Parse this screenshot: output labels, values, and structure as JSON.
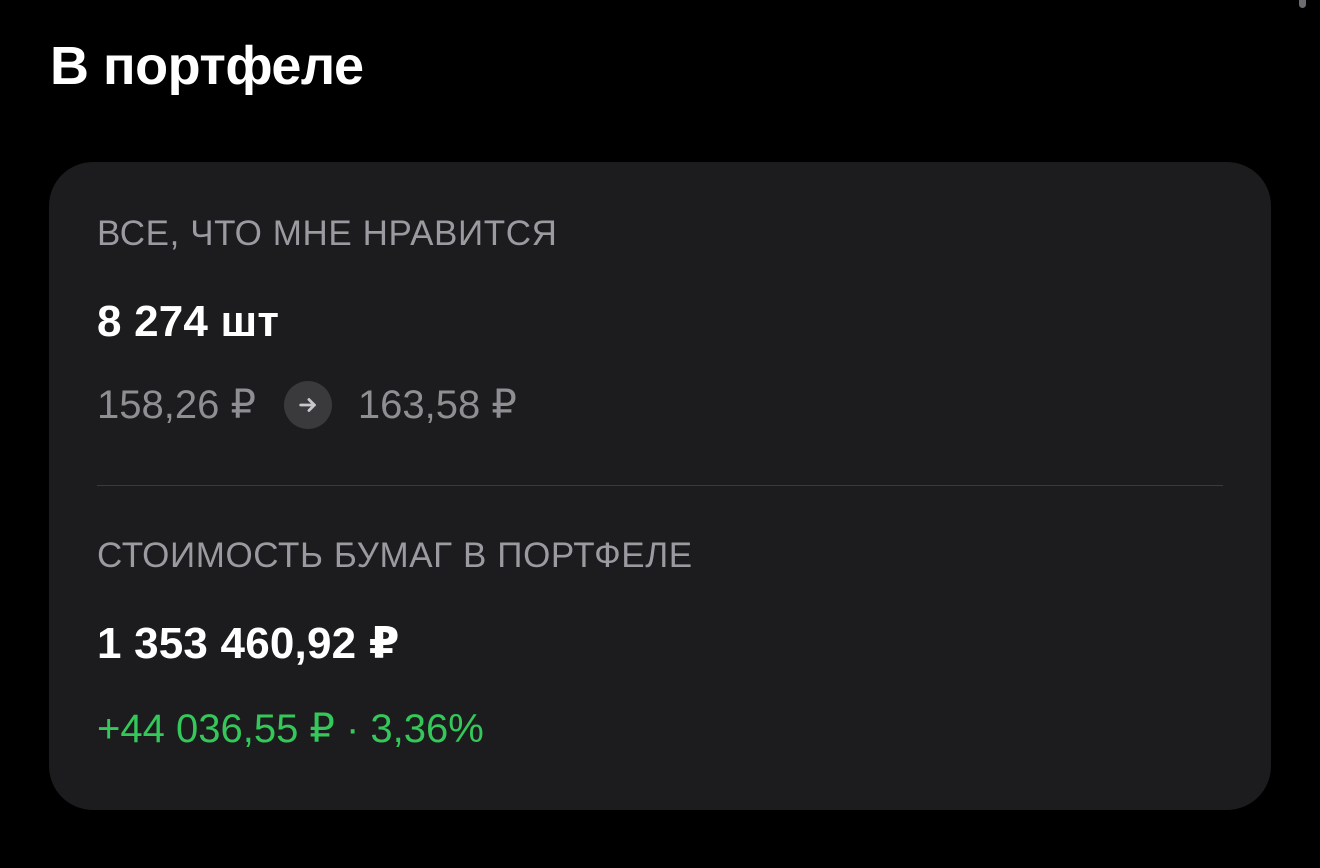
{
  "page": {
    "title": "В портфеле"
  },
  "card": {
    "favorites": {
      "label": "ВСЕ, ЧТО МНЕ НРАВИТСЯ",
      "quantity": "8 274 шт",
      "price_from": "158,26 ₽",
      "price_to": "163,58 ₽"
    },
    "portfolio_value": {
      "label": "СТОИМОСТЬ БУМАГ В ПОРТФЕЛЕ",
      "total": "1 353 460,92 ₽",
      "change": "+44 036,55 ₽ · 3,36%"
    }
  },
  "colors": {
    "background": "#000000",
    "card": "#1c1c1e",
    "secondary_text": "#8e8e93",
    "positive": "#34c759"
  },
  "icons": {
    "arrow": "arrow-right-icon"
  }
}
